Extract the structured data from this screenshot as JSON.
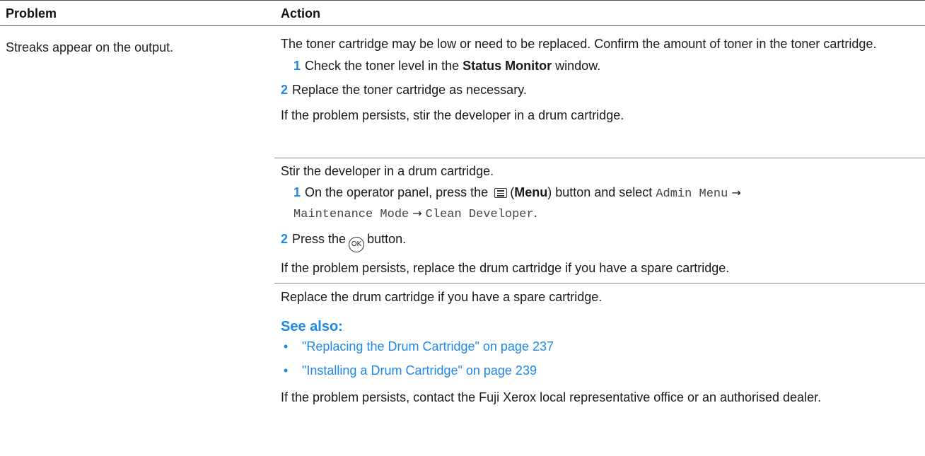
{
  "header": {
    "col_problem": "Problem",
    "col_action": "Action"
  },
  "problem": "Streaks appear on the output.",
  "block1": {
    "intro": "The toner cartridge may be low or need to be replaced. Confirm the amount of toner in the toner cartridge.",
    "step1_num": "1",
    "step1_pre": "Check the toner level in the ",
    "step1_bold": "Status Monitor",
    "step1_post": " window.",
    "step2_num": "2",
    "step2_text": "Replace the toner cartridge as necessary.",
    "outro": "If the problem persists, stir the developer in a drum cartridge."
  },
  "block2": {
    "intro": "Stir the developer in a drum cartridge.",
    "step1_num": "1",
    "step1_pre": "On the operator panel, press the",
    "step1_bold": "Menu",
    "step1_mid": ") button and select ",
    "menu_path_1": "Admin Menu",
    "menu_path_2": "Maintenance Mode",
    "menu_path_3": "Clean Developer",
    "arrow": "→",
    "step2_num": "2",
    "step2_pre": "Press the",
    "ok_label": "OK",
    "step2_post": "button.",
    "outro": "If the problem persists, replace the drum cartridge if you have a spare cartridge."
  },
  "block3": {
    "intro": "Replace the drum cartridge if you have a spare cartridge.",
    "see_also": "See also:",
    "links": [
      "\"Replacing the Drum Cartridge\" on page 237",
      "\"Installing a Drum Cartridge\" on page 239"
    ],
    "bullet": "•",
    "outro": "If the problem persists, contact the Fuji Xerox local representative office or an authorised dealer."
  },
  "colors": {
    "accent": "#1e88e5",
    "text": "#1a1a1a",
    "rule": "#555555"
  }
}
